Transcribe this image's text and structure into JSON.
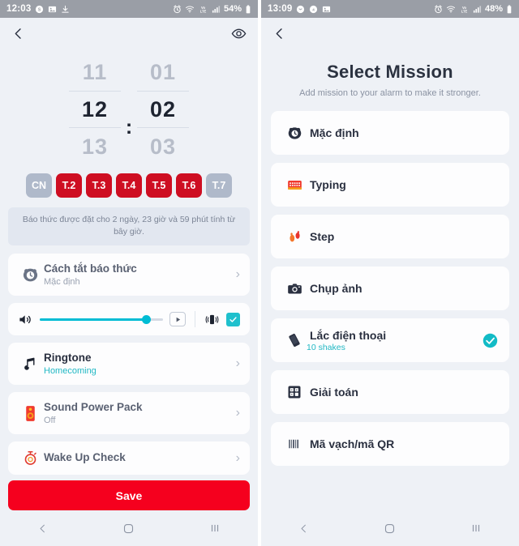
{
  "left": {
    "status_bar": {
      "time": "12:03",
      "battery": "54%",
      "icons": [
        "messaging-icon",
        "gallery-icon",
        "download-icon"
      ],
      "right_icons": [
        "alarm-icon",
        "wifi-icon",
        "lte-icon",
        "signal-icon",
        "battery-icon"
      ]
    },
    "appbar": {
      "back": "back-icon",
      "eye": "preview-eye-icon"
    },
    "time_picker": {
      "hour_prev": "11",
      "hour": "12",
      "hour_next": "13",
      "separator": ":",
      "minute_prev": "01",
      "minute": "02",
      "minute_next": "03"
    },
    "days": [
      {
        "label": "CN",
        "selected": false
      },
      {
        "label": "T.2",
        "selected": true
      },
      {
        "label": "T.3",
        "selected": true
      },
      {
        "label": "T.4",
        "selected": true
      },
      {
        "label": "T.5",
        "selected": true
      },
      {
        "label": "T.6",
        "selected": true
      },
      {
        "label": "T.7",
        "selected": false
      }
    ],
    "banner": "Báo thức được đặt cho 2 ngày, 23 giờ và 59 phút tính từ bây giờ.",
    "rows": [
      {
        "title": "Cách tắt báo thức",
        "sub": "Mặc định",
        "icon": "alarm-clock-icon"
      },
      {
        "title": "Ringtone",
        "sub": "Homecoming",
        "icon": "music-note-icon"
      },
      {
        "title": "Sound Power Pack",
        "sub": "Off",
        "icon": "speaker-icon"
      },
      {
        "title": "Wake Up Check",
        "sub": "",
        "icon": "stopwatch-icon"
      }
    ],
    "volume": {
      "icon": "volume-icon",
      "level": 86,
      "play": "play-icon",
      "vibrate": "vibrate-icon",
      "checkbox_checked": true
    },
    "save_label": "Save",
    "nav": {
      "back": "nav-back-icon",
      "home": "nav-home-icon",
      "recents": "nav-recents-icon"
    }
  },
  "right": {
    "status_bar": {
      "time": "13:09",
      "battery": "48%",
      "icons": [
        "messaging-icon",
        "email-icon",
        "gallery-icon"
      ],
      "right_icons": [
        "alarm-icon",
        "wifi-icon",
        "lte-icon",
        "signal-icon",
        "battery-icon"
      ]
    },
    "appbar": {
      "back": "back-icon"
    },
    "title": "Select Mission",
    "subtitle": "Add mission to your alarm to make it stronger.",
    "missions": [
      {
        "label": "Mặc định",
        "sub": "",
        "icon": "alarm-clock-icon",
        "selected": false
      },
      {
        "label": "Typing",
        "sub": "",
        "icon": "keyboard-icon",
        "selected": false
      },
      {
        "label": "Step",
        "sub": "",
        "icon": "footsteps-icon",
        "selected": false
      },
      {
        "label": "Chụp ảnh",
        "sub": "",
        "icon": "camera-icon",
        "selected": false
      },
      {
        "label": "Lắc điện thoại",
        "sub": "10 shakes",
        "icon": "shake-phone-icon",
        "selected": true
      },
      {
        "label": "Giải toán",
        "sub": "",
        "icon": "math-grid-icon",
        "selected": false
      },
      {
        "label": "Mã vạch/mã QR",
        "sub": "",
        "icon": "barcode-icon",
        "selected": false
      }
    ],
    "nav": {
      "back": "nav-back-icon",
      "home": "nav-home-icon",
      "recents": "nav-recents-icon"
    }
  },
  "colors": {
    "accent_red": "#CE0E22",
    "save_red": "#F5001E",
    "teal": "#00BCD4",
    "bg": "#EEF1F6"
  }
}
